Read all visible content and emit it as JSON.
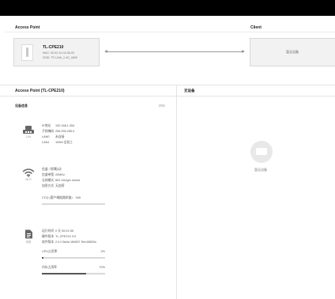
{
  "header": {
    "access_point_label": "Access Point",
    "client_label": "Client"
  },
  "ap_card": {
    "name": "TL-CPE210",
    "mac": "MAC: 00-02-10-03-08-09",
    "ssid": "SSID: TP-LINK_2.4G_0809"
  },
  "client_card": {
    "empty_text": "暂无设备"
  },
  "detail": {
    "ap_title": "Access Point (TL-CPE210)",
    "client_title": "无设备",
    "device_info_label": "设备信息",
    "refresh_label": "刷新"
  },
  "lan": {
    "icon_label": "LAN",
    "rows": [
      {
        "key": "IP地址",
        "value": "192.168.1.254"
      },
      {
        "key": "子网掩码",
        "value": "255.255.255.0"
      },
      {
        "key": "LAN0",
        "value": "未连接"
      },
      {
        "key": "LAN1",
        "value": "100M 全双工"
      }
    ]
  },
  "wifi": {
    "icon_label": "Wi-Fi",
    "rows": [
      {
        "key": "信道 / 频率",
        "value": "自动"
      },
      {
        "key": "信道带宽",
        "value": "20MHz"
      },
      {
        "key": "无线模式",
        "value": "802.11b/g/n mixed"
      },
      {
        "key": "加密方式",
        "value": "无加密"
      }
    ],
    "ccq_label": "CCQ (客户端链路质量)",
    "ccq_value": "N/A"
  },
  "system": {
    "icon_label": "系统",
    "rows": [
      {
        "key": "运行时间",
        "value": "0 天 00:01:08"
      },
      {
        "key": "硬件版本",
        "value": "TL-CPE210 3.0"
      },
      {
        "key": "软件版本",
        "value": "2.0.0 Build 180807 Rel.68520n"
      }
    ],
    "cpu_label": "CPU占用率",
    "cpu_value": "2%",
    "cpu_fraction": 0.02,
    "mem_label": "内存占用率",
    "mem_value": "70%",
    "mem_fraction": 0.7
  },
  "client_panel": {
    "empty_text": "暂无设备"
  },
  "colors": {
    "top_bar": "#000000",
    "bar_fill": "#555555",
    "bar_track": "#d9d9d9",
    "card_bg": "#f2f2f2"
  }
}
